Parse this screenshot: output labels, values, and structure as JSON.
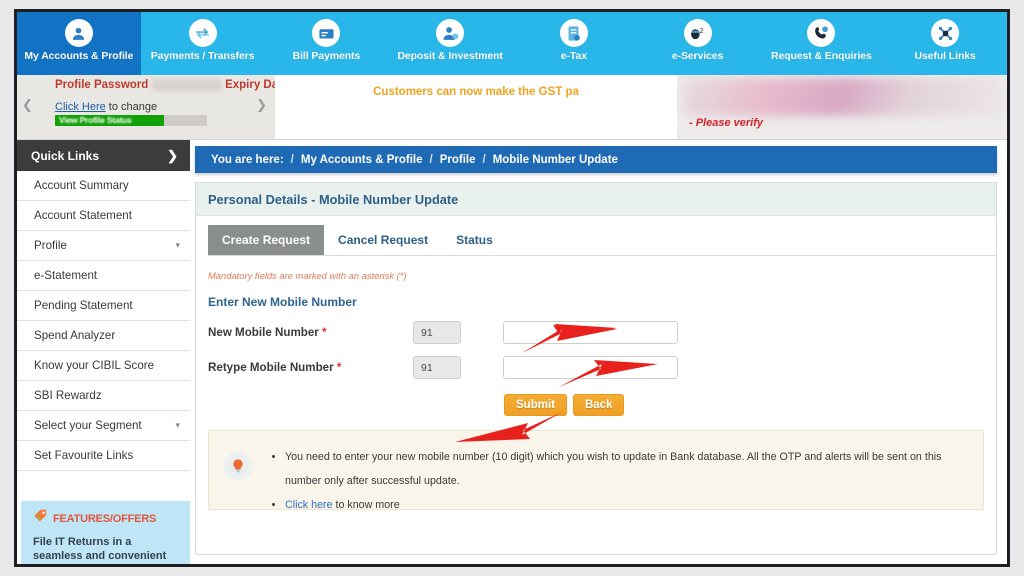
{
  "colors": {
    "nav_bg": "#29b6e8",
    "nav_active": "#1272c4",
    "breadcrumb_bg": "#1e6ab4",
    "button_orange": "#eea024",
    "arrow_red": "#e8211c",
    "required_star": "#d6352a",
    "info_bg": "#faf5ea",
    "features_bg": "#bfe6f7"
  },
  "topnav": {
    "items": [
      {
        "label": "My Accounts & Profile",
        "icon": "user-icon",
        "active": true
      },
      {
        "label": "Payments / Transfers",
        "icon": "transfer-arrows-icon",
        "active": false
      },
      {
        "label": "Bill Payments",
        "icon": "bill-envelope-icon",
        "active": false
      },
      {
        "label": "Deposit & Investment",
        "icon": "deposit-person-icon",
        "active": false
      },
      {
        "label": "e-Tax",
        "icon": "tax-document-icon",
        "active": false
      },
      {
        "label": "e-Services",
        "icon": "mouse-services-icon",
        "active": false
      },
      {
        "label": "Request & Enquiries",
        "icon": "phone-enquiry-icon",
        "active": false
      },
      {
        "label": "Useful Links",
        "icon": "links-network-icon",
        "active": false
      }
    ]
  },
  "ticker": {
    "profile": {
      "expiry_prefix": "Profile Password",
      "expiry_redacted": "xxxxxxxxxxx",
      "expiry_suffix": "Expiry Date",
      "change_link": "Click Here",
      "change_text": "to change",
      "status_text": "View Profile Status",
      "prev_icon": "chevron-left-icon",
      "next_icon": "chevron-right-icon"
    },
    "gst_message": "Customers can now make the GST pa",
    "verify_note": "- Please verify"
  },
  "sidebar": {
    "header": {
      "label": "Quick Links",
      "icon": "chevron-right-icon"
    },
    "items": [
      {
        "label": "Account Summary",
        "caret": false
      },
      {
        "label": "Account Statement",
        "caret": false
      },
      {
        "label": "Profile",
        "caret": true
      },
      {
        "label": "e-Statement",
        "caret": false
      },
      {
        "label": "Pending Statement",
        "caret": false
      },
      {
        "label": "Spend Analyzer",
        "caret": false
      },
      {
        "label": "Know your CIBIL Score",
        "caret": false
      },
      {
        "label": "SBI Rewardz",
        "caret": false
      },
      {
        "label": "Select your Segment",
        "caret": true
      },
      {
        "label": "Set Favourite Links",
        "caret": false
      }
    ],
    "features": {
      "title": "FEATURES/OFFERS",
      "icon": "offer-tag-icon",
      "body": "File IT Returns in a seamless and convenient"
    }
  },
  "breadcrumb": {
    "prefix": "You are here:",
    "items": [
      "My Accounts & Profile",
      "Profile",
      "Mobile Number Update"
    ],
    "separator": "/"
  },
  "card": {
    "title": "Personal Details - Mobile Number Update",
    "tabs": [
      {
        "label": "Create Request",
        "active": true
      },
      {
        "label": "Cancel Request",
        "active": false
      },
      {
        "label": "Status",
        "active": false
      }
    ],
    "mandatory_note": "Mandatory fields are marked with an asterisk (*)",
    "section_title": "Enter New Mobile Number",
    "fields": [
      {
        "label": "New Mobile Number",
        "required": "*",
        "prefix": "91",
        "value": "",
        "placeholder": ""
      },
      {
        "label": "Retype Mobile Number",
        "required": "*",
        "prefix": "91",
        "value": "",
        "placeholder": ""
      }
    ],
    "buttons": [
      {
        "label": "Submit",
        "name": "submit-button"
      },
      {
        "label": "Back",
        "name": "back-button"
      }
    ],
    "info": {
      "icon": "lightbulb-icon",
      "bullets": [
        "You need to enter your new mobile number (10 digit) which you wish to update in Bank database. All the OTP and alerts will be sent on this number only after successful update.",
        ""
      ],
      "link_text": "Click here",
      "link_suffix": "to know more"
    }
  },
  "annotations": {
    "arrows": [
      {
        "name": "arrow-to-new-mobile-field"
      },
      {
        "name": "arrow-to-retype-mobile-field"
      },
      {
        "name": "arrow-to-submit-button"
      }
    ]
  }
}
